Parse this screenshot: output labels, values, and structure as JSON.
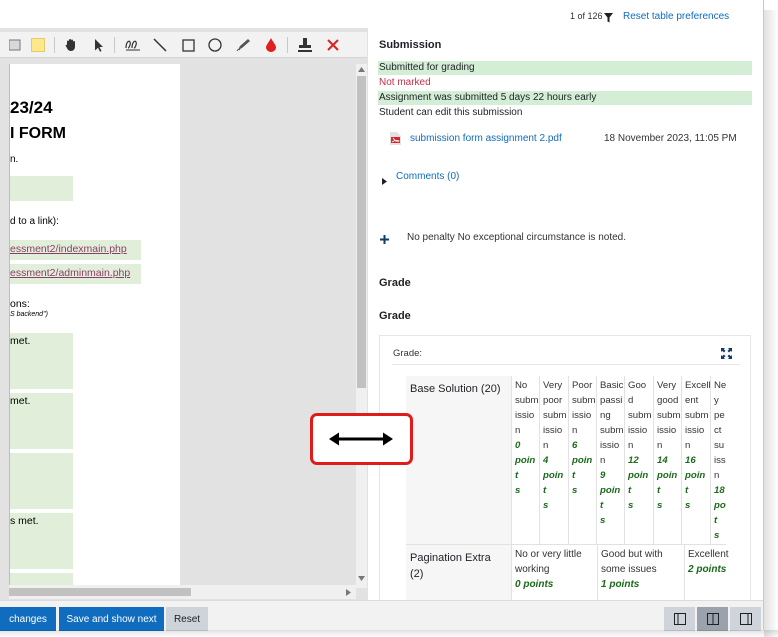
{
  "colors": {
    "accent": "#0f6cbf",
    "status_green": "#d4eed6",
    "not_marked": "#c4314b",
    "points_green": "#1a6a1a",
    "annotation_red": "#e01b1b"
  },
  "topbar": {
    "pagination": "1 of 126",
    "filter_icon": "filter-icon",
    "reset_preferences": "Reset table preferences"
  },
  "pdf_toolbar": {
    "tools": [
      "stamp-list-icon",
      "highlight-swatch-icon",
      "hand-pan-icon",
      "pointer-icon",
      "comment-icon",
      "line-icon",
      "rectangle-icon",
      "oval-icon",
      "pen-icon",
      "color-drop-icon",
      "stamp-icon",
      "delete-icon"
    ]
  },
  "pdf": {
    "lines": [
      {
        "text": "23/24"
      },
      {
        "text": "I FORM"
      },
      {
        "text": "n."
      },
      {
        "text": "d to a link):"
      },
      {
        "text": "essment2/indexmain.php"
      },
      {
        "text": "essment2/adminmain.php"
      },
      {
        "text": "ons:"
      },
      {
        "text": "S backend\")"
      },
      {
        "text": "met."
      },
      {
        "text": "met."
      },
      {
        "text": "s met."
      }
    ]
  },
  "submission": {
    "heading": "Submission",
    "submitted_for_grading": "Submitted for grading",
    "not_marked": "Not marked",
    "submitted_early": "Assignment was submitted 5 days 22 hours early",
    "student_can_edit": "Student can edit this submission",
    "file_name": "submission form assignment 2.pdf",
    "file_date": "18 November 2023, 11:05 PM",
    "comments": "Comments (0)",
    "penalty": "No penalty No exceptional circumstance is noted."
  },
  "grade": {
    "heading_1": "Grade",
    "heading_2": "Grade",
    "rubric_label": "Grade:",
    "criteria": [
      {
        "name": "Base Solution (20)",
        "levels": [
          {
            "lines": [
              "No",
              "subm",
              "issio",
              "n"
            ],
            "points": [
              "0",
              "poin",
              "t",
              "s"
            ]
          },
          {
            "lines": [
              "Very",
              "poor",
              "subm",
              "issio",
              "n"
            ],
            "points": [
              "4",
              "poin",
              "t",
              "s"
            ]
          },
          {
            "lines": [
              "Poor",
              "subm",
              "issio",
              "n"
            ],
            "points": [
              "6",
              "poin",
              "t",
              "s"
            ]
          },
          {
            "lines": [
              "Basic",
              "passi",
              "ng",
              "subm",
              "issio",
              "n"
            ],
            "points": [
              "9",
              "poin",
              "t",
              "s"
            ]
          },
          {
            "lines": [
              "Goo",
              "d",
              "subm",
              "issio",
              "n"
            ],
            "points": [
              "12",
              "poin",
              "t",
              "s"
            ]
          },
          {
            "lines": [
              "Very",
              "good",
              "subm",
              "issio",
              "n"
            ],
            "points": [
              "14",
              "poin",
              "t",
              "s"
            ]
          },
          {
            "lines": [
              "Excell",
              "ent",
              "subm",
              "issio",
              "n"
            ],
            "points": [
              "16",
              "poin",
              "t",
              "s"
            ]
          },
          {
            "lines": [
              "Ne",
              "y",
              "pe",
              "ct",
              "su",
              "iss",
              "n"
            ],
            "points": [
              "18",
              "po",
              "t",
              "s"
            ]
          }
        ]
      },
      {
        "name": "Pagination Extra (2)",
        "name_lines": [
          "Pagination Extra",
          "(2)"
        ],
        "levels": [
          {
            "lines": [
              "No or very little",
              "working"
            ],
            "points": "0 points"
          },
          {
            "lines": [
              "Good but with",
              "some issues"
            ],
            "points": "1 points"
          },
          {
            "lines": [
              "Excellent"
            ],
            "points": "2 points"
          }
        ]
      }
    ]
  },
  "footer": {
    "save_changes": "changes",
    "save_show_next": "Save and show next",
    "reset": "Reset",
    "view_modes": [
      "collapse-review-panel-icon",
      "default-view-icon",
      "collapse-grade-panel-icon"
    ]
  },
  "annotation": {
    "arrow": "resize-arrow-icon"
  }
}
